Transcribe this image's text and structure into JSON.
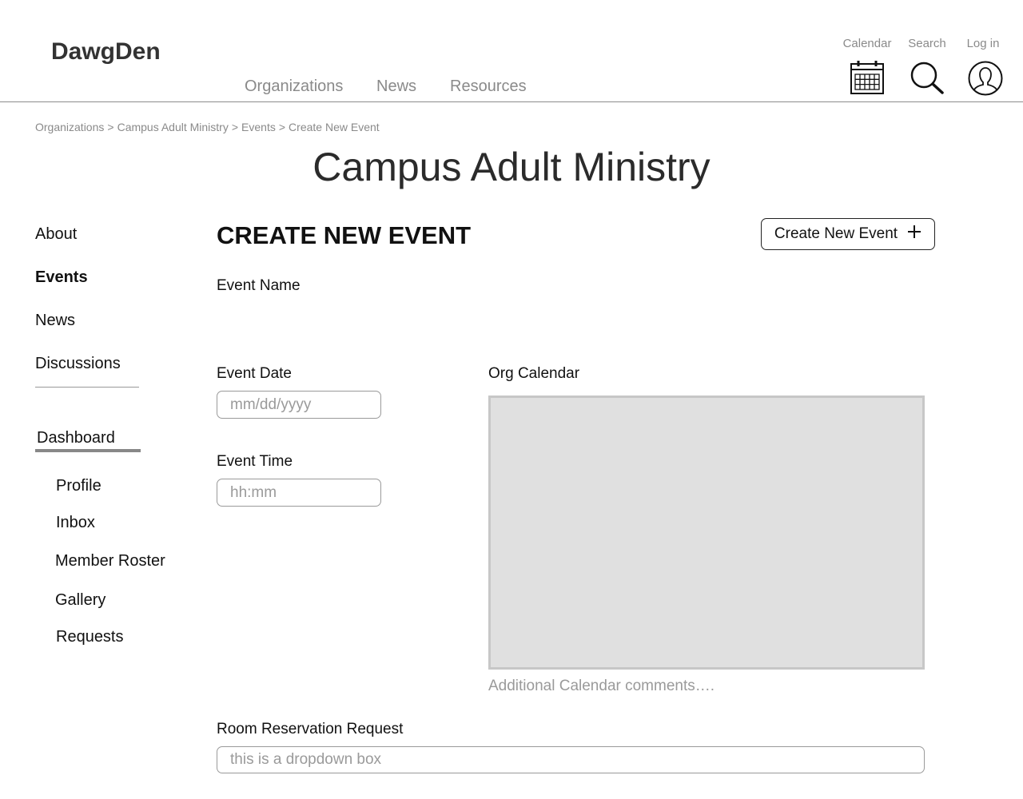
{
  "header": {
    "brand": "DawgDen",
    "nav": [
      "Organizations",
      "News",
      "Resources"
    ],
    "utilities": {
      "calendar_label": "Calendar",
      "search_label": "Search",
      "login_label": "Log in"
    }
  },
  "breadcrumb": [
    "Organizations",
    ">",
    "Campus Adult Ministry",
    ">",
    "Events",
    ">",
    "Create New Event"
  ],
  "org_title": "Campus Adult Ministry",
  "sidebar": {
    "items": [
      "About",
      "Events",
      "News",
      "Discussions"
    ],
    "active": "Events",
    "dashboard_label": "Dashboard",
    "dashboard_items": [
      "Profile",
      "Inbox",
      "Member Roster",
      "Gallery",
      "Requests"
    ]
  },
  "main": {
    "section_title": "CREATE NEW EVENT",
    "create_button_label": "Create New Event",
    "event_name_label": "Event Name",
    "event_date_label": "Event Date",
    "event_date_placeholder": "mm/dd/yyyy",
    "event_time_label": "Event Time",
    "event_time_placeholder": "hh:mm",
    "org_calendar_label": "Org Calendar",
    "calendar_comment": "Additional Calendar comments….",
    "room_request_label": "Room Reservation Request",
    "room_request_placeholder": "this is a dropdown box"
  }
}
